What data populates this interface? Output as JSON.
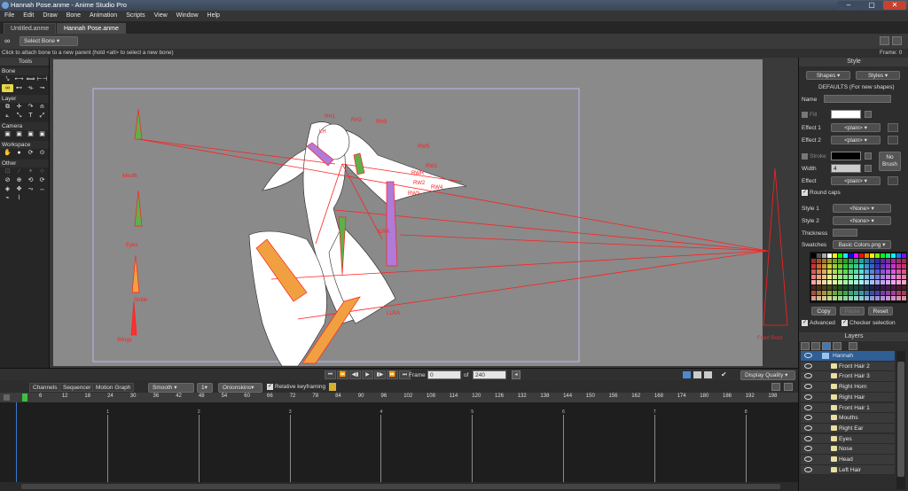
{
  "window": {
    "title": "Hannah Pose.anme - Anime Studio Pro",
    "minimize": "–",
    "maximize": "▢",
    "close": "✕"
  },
  "menu": [
    "File",
    "Edit",
    "Draw",
    "Bone",
    "Animation",
    "Scripts",
    "View",
    "Window",
    "Help"
  ],
  "tabs": [
    {
      "label": "Untitled.anme",
      "active": false
    },
    {
      "label": "Hannah Pose.anme",
      "active": true
    }
  ],
  "tool_options": {
    "select_bone": "Select Bone"
  },
  "status": {
    "message": "Click to attach bone to a new parent (hold <alt> to select a new bone)",
    "frame_readout": "Frame: 0"
  },
  "tools": {
    "title": "Tools",
    "sections": [
      {
        "name": "Bone",
        "rows": [
          [
            "⤥",
            "⟷",
            "⟺",
            "⊢⊣"
          ],
          [
            "∞",
            "⊷",
            "⟛",
            "⊸"
          ]
        ]
      },
      {
        "name": "Layer",
        "rows": [
          [
            "⧉",
            "✛",
            "↷",
            "⍝"
          ],
          [
            "⟀",
            "⤡",
            "T",
            "⤢"
          ]
        ]
      },
      {
        "name": "Camera",
        "rows": [
          [
            "▣",
            "▣",
            "▣",
            "▣"
          ]
        ]
      },
      {
        "name": "Workspace",
        "rows": [
          [
            "✋",
            "●",
            "⟳",
            "⊙"
          ]
        ]
      },
      {
        "name": "Other",
        "rows": [
          [
            "⊡",
            "∕",
            "✦",
            "⊹"
          ],
          [
            "⊘",
            "⊕",
            "⟲",
            "⟳"
          ],
          [
            "◈",
            "✥",
            "⤳",
            "↔"
          ],
          [
            "⌁",
            "⌇",
            "",
            ""
          ]
        ]
      }
    ]
  },
  "bone_labels": {
    "mouth": "Mouth",
    "eyes": "Eyes",
    "smile": "Smile",
    "wings": "Wings",
    "front_root": "Front Root",
    "rwr": "RWR",
    "rw1": "RW1",
    "rw2": "RW2",
    "rw3": "RW3",
    "rw4": "RW4",
    "rw5": "RW5",
    "ilra": "ILRA",
    "llra": "LLRA",
    "rh1": "RH1",
    "rh2": "RH2",
    "rh3": "RH3",
    "lh": "LH"
  },
  "transport": {
    "frame_label": "Frame",
    "frame_value": "0",
    "of_label": "of",
    "end_value": "240",
    "display_quality": "Display Quality",
    "buttons": [
      "⏮",
      "⏪",
      "◀▮",
      "▶",
      "▮▶",
      "⏩",
      "⏭"
    ]
  },
  "timeline": {
    "tabs": [
      "Channels",
      "Sequencer",
      "Motion Graph"
    ],
    "interp": "Smooth",
    "interp_count": "1",
    "onionskins": "Onionskins",
    "relative_keyframing": "Relative keyframing",
    "ruler_ticks": [
      "6",
      "12",
      "18",
      "24",
      "30",
      "36",
      "42",
      "48",
      "54",
      "60",
      "66",
      "72",
      "78",
      "84",
      "90",
      "96",
      "102",
      "108",
      "114",
      "120",
      "126",
      "132",
      "138",
      "144",
      "150",
      "156",
      "162",
      "168",
      "174",
      "180",
      "186",
      "192",
      "198"
    ],
    "second_marks": [
      "1",
      "2",
      "3",
      "4",
      "5",
      "6",
      "7",
      "8"
    ]
  },
  "style_panel": {
    "title": "Style",
    "shapes": "Shapes",
    "styles": "Styles",
    "defaults": "DEFAULTS (For new shapes)",
    "name_label": "Name",
    "fill_label": "Fill",
    "fill_color": "#ffffff",
    "effect1_label": "Effect 1",
    "effect1_value": "<plain>",
    "effect2_label": "Effect 2",
    "effect2_value": "<plain>",
    "stroke_label": "Stroke",
    "stroke_color": "#000000",
    "width_label": "Width",
    "width_value": "4",
    "no_brush_1": "No",
    "no_brush_2": "Brush",
    "effect_label": "Effect",
    "effect_value": "<plain>",
    "round_caps": "Round caps",
    "style1_label": "Style 1",
    "style1_value": "<None>",
    "style2_label": "Style 2",
    "style2_value": "<None>",
    "thickness_label": "Thickness",
    "swatches_label": "Swatches",
    "swatches_value": "Basic Colors.png",
    "copy": "Copy",
    "paste": "Paste",
    "reset": "Reset",
    "advanced": "Advanced",
    "checker_selection": "Checker selection"
  },
  "layers_panel": {
    "title": "Layers",
    "items": [
      {
        "name": "Hannah",
        "active": true
      },
      {
        "name": "Front Hair 2",
        "active": false
      },
      {
        "name": "Front Hair 3",
        "active": false
      },
      {
        "name": "Right Horn",
        "active": false
      },
      {
        "name": "Right Hair",
        "active": false
      },
      {
        "name": "Front Hair 1",
        "active": false
      },
      {
        "name": "Mouths",
        "active": false
      },
      {
        "name": "Right Ear",
        "active": false
      },
      {
        "name": "Eyes",
        "active": false
      },
      {
        "name": "Nose",
        "active": false
      },
      {
        "name": "Head",
        "active": false
      },
      {
        "name": "Left Hair",
        "active": false
      }
    ]
  },
  "colors": {
    "accent_select": "#e6d84a",
    "layer_active": "#2f5f95",
    "bone_red": "#ff2020",
    "canvas_gray": "#8a8a8a"
  }
}
